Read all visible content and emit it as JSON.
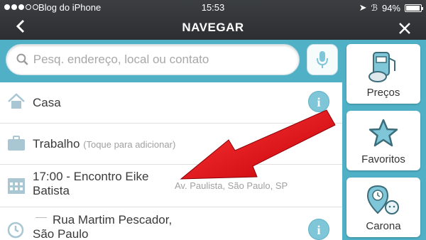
{
  "status_bar": {
    "carrier": "Blog do iPhone",
    "time": "15:53",
    "battery_percent": "94%",
    "battery_level": 0.94
  },
  "nav": {
    "title": "NAVEGAR",
    "back_icon": "chevron-left-icon",
    "close_icon": "close-icon"
  },
  "search": {
    "placeholder": "Pesq. endereço, local ou contato"
  },
  "list": {
    "home": {
      "title": "Casa"
    },
    "work": {
      "title": "Trabalho",
      "hint": "(Toque para adicionar)"
    },
    "event": {
      "title_line1": "17:00 - Encontro Eike",
      "title_line2": "Batista",
      "address": "Av. Paulista, São Paulo, SP"
    },
    "recent": {
      "title_line1": "Rua Martim Pescador,",
      "title_line2": "São Paulo"
    }
  },
  "side_buttons": {
    "prices": "Preços",
    "favorites": "Favoritos",
    "carpool": "Carona"
  },
  "colors": {
    "accent": "#4fb0c6",
    "arrow": "#e8151b"
  }
}
